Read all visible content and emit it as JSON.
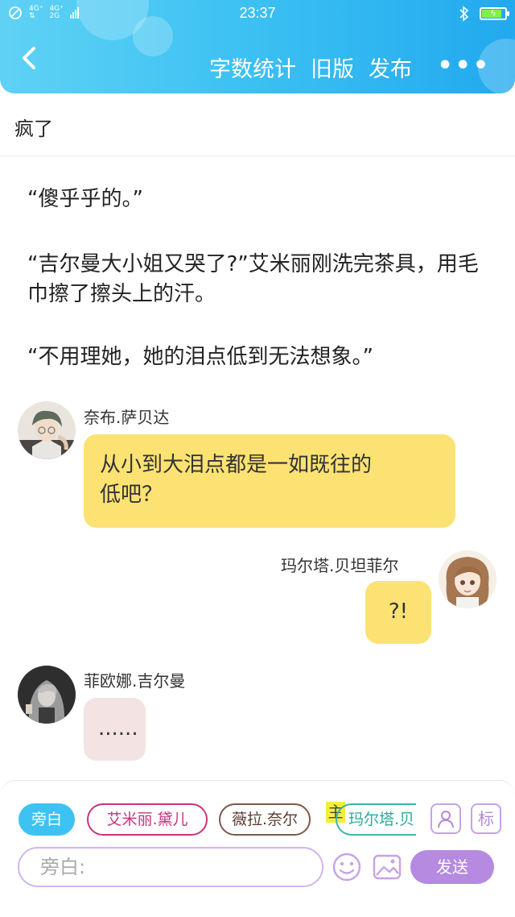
{
  "status_bar": {
    "net_top": "4G⁺",
    "net2_top": "4G⁺",
    "net2_bottom": "2G",
    "time": "23:37"
  },
  "header": {
    "actions": [
      "字数统计",
      "旧版",
      "发布"
    ],
    "more": "•••"
  },
  "title": "疯了",
  "narration": [
    "“傻乎乎的。”",
    "“吉尔曼大小姐又哭了?”艾米丽刚洗完茶具，用毛巾擦了擦头上的汗。",
    "“不用理她，她的泪点低到无法想象。”"
  ],
  "messages": [
    {
      "speaker": "奈布.萨贝达",
      "text_line1": "从小到大泪点都是一如既往的",
      "text_line2": "低吧？"
    },
    {
      "speaker": "玛尔塔.贝坦菲尔",
      "text": "?!"
    },
    {
      "speaker": "菲欧娜.吉尔曼",
      "text": "......"
    }
  ],
  "composer": {
    "chips": [
      "旁白",
      "艾米丽.黛儿",
      "薇拉.奈尔",
      "玛尔塔.贝"
    ],
    "main_tag": "主",
    "tag_button": "标",
    "placeholder": "旁白:",
    "send": "发送"
  },
  "colors": {
    "header_blue": "#3ec2f3",
    "bubble_yellow": "#fbe273",
    "bubble_pink": "#f3e3e3",
    "send_purple": "#b58ae0"
  }
}
